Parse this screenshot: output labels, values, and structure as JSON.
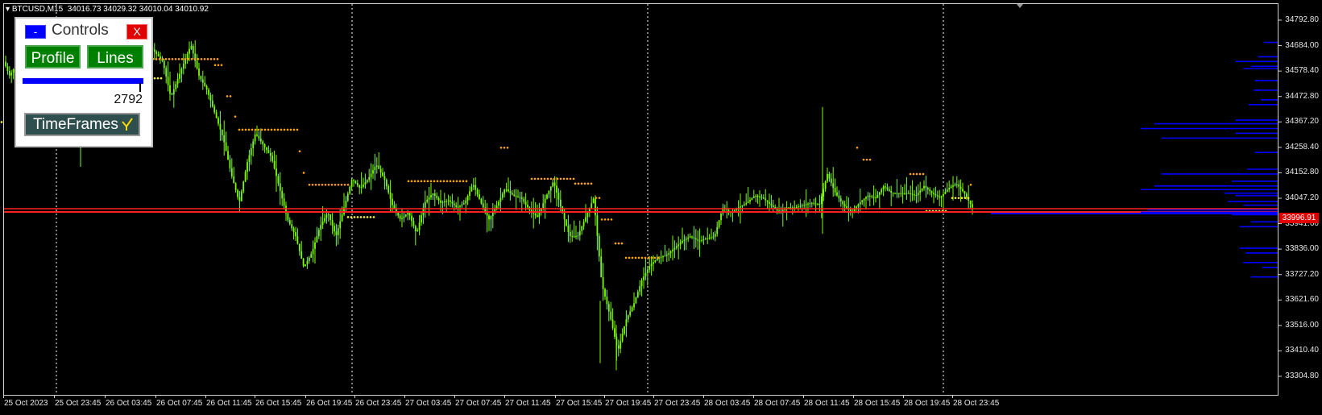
{
  "header": {
    "symbol": "BTCUSD,M15",
    "ohlc": "34016.73 34029.32 34010.04 34010.92"
  },
  "price_axis": {
    "labels": [
      "34792.80",
      "34684.00",
      "34578.40",
      "34472.80",
      "34367.20",
      "34258.40",
      "34152.80",
      "34047.20",
      "33941.60",
      "33836.00",
      "33727.20",
      "33621.60",
      "33516.00",
      "33410.40",
      "33304.80"
    ],
    "current_price": "33996.91"
  },
  "time_axis": {
    "labels": [
      "25 Oct 2023",
      "25 Oct 23:45",
      "26 Oct 03:45",
      "26 Oct 07:45",
      "26 Oct 11:45",
      "26 Oct 15:45",
      "26 Oct 19:45",
      "26 Oct 23:45",
      "27 Oct 03:45",
      "27 Oct 07:45",
      "27 Oct 11:45",
      "27 Oct 15:45",
      "27 Oct 19:45",
      "27 Oct 23:45",
      "28 Oct 03:45",
      "28 Oct 07:45",
      "28 Oct 11:45",
      "28 Oct 15:45",
      "28 Oct 19:45",
      "28 Oct 23:45"
    ]
  },
  "controls": {
    "minimize_label": "-",
    "title": "Controls",
    "close_label": "X",
    "profile_button": "Profile",
    "lines_button": "Lines",
    "slider_value": "2792",
    "timeframes_label": "TimeFrames"
  },
  "colors": {
    "background": "#000000",
    "candles": "#7CFC00",
    "red_line": "#ff2020",
    "profile_bars": "#0000ff",
    "dots_orange": "#ffa500",
    "dots_yellow": "#ffff00",
    "grid": "#ffffff"
  },
  "chart_data": {
    "type": "candlestick",
    "symbol": "BTCUSD",
    "timeframe": "M15",
    "ylim": [
      33260,
      34850
    ],
    "horizontal_level": 33996.91,
    "path_points": [
      [
        0,
        34640
      ],
      [
        10,
        34560
      ],
      [
        20,
        34620
      ],
      [
        30,
        34460
      ],
      [
        40,
        34530
      ],
      [
        55,
        34610
      ],
      [
        66,
        34380
      ],
      [
        80,
        34500
      ],
      [
        95,
        34310
      ],
      [
        110,
        34480
      ],
      [
        125,
        34600
      ],
      [
        140,
        34520
      ],
      [
        155,
        34640
      ],
      [
        170,
        34600
      ],
      [
        185,
        34680
      ],
      [
        200,
        34620
      ],
      [
        210,
        34470
      ],
      [
        220,
        34560
      ],
      [
        235,
        34690
      ],
      [
        245,
        34560
      ],
      [
        255,
        34500
      ],
      [
        265,
        34400
      ],
      [
        275,
        34300
      ],
      [
        285,
        34150
      ],
      [
        295,
        34030
      ],
      [
        305,
        34200
      ],
      [
        315,
        34320
      ],
      [
        325,
        34270
      ],
      [
        335,
        34220
      ],
      [
        345,
        34090
      ],
      [
        355,
        33960
      ],
      [
        365,
        33890
      ],
      [
        375,
        33760
      ],
      [
        385,
        33820
      ],
      [
        395,
        33930
      ],
      [
        405,
        33990
      ],
      [
        415,
        33890
      ],
      [
        425,
        34010
      ],
      [
        435,
        34130
      ],
      [
        445,
        34090
      ],
      [
        455,
        34130
      ],
      [
        465,
        34190
      ],
      [
        475,
        34130
      ],
      [
        485,
        34020
      ],
      [
        495,
        33960
      ],
      [
        505,
        33990
      ],
      [
        515,
        33900
      ],
      [
        525,
        34030
      ],
      [
        535,
        34070
      ],
      [
        545,
        34030
      ],
      [
        555,
        34040
      ],
      [
        565,
        34010
      ],
      [
        575,
        34030
      ],
      [
        585,
        34110
      ],
      [
        595,
        34030
      ],
      [
        605,
        33960
      ],
      [
        615,
        34020
      ],
      [
        625,
        34090
      ],
      [
        635,
        34060
      ],
      [
        645,
        34050
      ],
      [
        655,
        34000
      ],
      [
        665,
        33970
      ],
      [
        675,
        34050
      ],
      [
        685,
        34120
      ],
      [
        695,
        34000
      ],
      [
        705,
        33890
      ],
      [
        715,
        33890
      ],
      [
        725,
        33970
      ],
      [
        735,
        34050
      ],
      [
        745,
        33690
      ],
      [
        755,
        33560
      ],
      [
        765,
        33410
      ],
      [
        775,
        33540
      ],
      [
        785,
        33610
      ],
      [
        795,
        33710
      ],
      [
        805,
        33770
      ],
      [
        815,
        33800
      ],
      [
        825,
        33810
      ],
      [
        835,
        33840
      ],
      [
        845,
        33870
      ],
      [
        855,
        33890
      ],
      [
        865,
        33870
      ],
      [
        875,
        33880
      ],
      [
        885,
        33890
      ],
      [
        895,
        34010
      ],
      [
        905,
        33990
      ],
      [
        915,
        34010
      ],
      [
        925,
        34030
      ],
      [
        935,
        34060
      ],
      [
        945,
        34050
      ],
      [
        955,
        34020
      ],
      [
        965,
        33990
      ],
      [
        975,
        34010
      ],
      [
        985,
        34010
      ],
      [
        995,
        34020
      ],
      [
        1005,
        34030
      ],
      [
        1015,
        34020
      ],
      [
        1025,
        34150
      ],
      [
        1035,
        34070
      ],
      [
        1045,
        34020
      ],
      [
        1055,
        33990
      ],
      [
        1065,
        34030
      ],
      [
        1075,
        34060
      ],
      [
        1085,
        34050
      ],
      [
        1095,
        34100
      ],
      [
        1105,
        34070
      ],
      [
        1115,
        34070
      ],
      [
        1125,
        34070
      ],
      [
        1135,
        34060
      ],
      [
        1145,
        34100
      ],
      [
        1155,
        34070
      ],
      [
        1165,
        34050
      ],
      [
        1175,
        34090
      ],
      [
        1185,
        34110
      ],
      [
        1195,
        34070
      ],
      [
        1205,
        34010
      ]
    ],
    "dot_steps": [
      [
        0,
        3,
        34367,
        "yellow"
      ],
      [
        180,
        270,
        34630,
        "orange"
      ],
      [
        190,
        200,
        34550,
        "yellow"
      ],
      [
        265,
        275,
        34605,
        "orange"
      ],
      [
        280,
        287,
        34475,
        "orange"
      ],
      [
        290,
        292,
        34390,
        "orange"
      ],
      [
        295,
        370,
        34335,
        "orange"
      ],
      [
        370,
        372,
        34245,
        "orange"
      ],
      [
        375,
        378,
        34155,
        "orange"
      ],
      [
        382,
        430,
        34105,
        "orange"
      ],
      [
        430,
        465,
        33970,
        "yellow"
      ],
      [
        505,
        580,
        34120,
        "orange"
      ],
      [
        620,
        630,
        34260,
        "orange"
      ],
      [
        658,
        710,
        34130,
        "orange"
      ],
      [
        712,
        735,
        34110,
        "orange"
      ],
      [
        738,
        742,
        34050,
        "orange"
      ],
      [
        745,
        760,
        33960,
        "orange"
      ],
      [
        762,
        772,
        33860,
        "orange"
      ],
      [
        775,
        815,
        33800,
        "orange"
      ],
      [
        1062,
        1065,
        34260,
        "orange"
      ],
      [
        1070,
        1078,
        34210,
        "orange"
      ],
      [
        1128,
        1145,
        34150,
        "orange"
      ],
      [
        1148,
        1175,
        33995,
        "yellow"
      ],
      [
        1180,
        1200,
        34050,
        "yellow"
      ],
      [
        1203,
        1205,
        34105,
        "orange"
      ]
    ],
    "volume_profile": [
      [
        34700,
        0.18
      ],
      [
        34640,
        0.26
      ],
      [
        34620,
        0.55
      ],
      [
        34600,
        0.35
      ],
      [
        34590,
        0.45
      ],
      [
        34540,
        0.3
      ],
      [
        34500,
        0.32
      ],
      [
        34460,
        0.22
      ],
      [
        34440,
        0.38
      ],
      [
        34375,
        0.55
      ],
      [
        34360,
        0.9
      ],
      [
        34340,
        1.0
      ],
      [
        34320,
        0.55
      ],
      [
        34300,
        0.85
      ],
      [
        34240,
        0.3
      ],
      [
        34170,
        0.4
      ],
      [
        34150,
        0.85
      ],
      [
        34120,
        0.6
      ],
      [
        34100,
        0.9
      ],
      [
        34085,
        1.0
      ],
      [
        34070,
        0.7
      ],
      [
        34060,
        0.55
      ],
      [
        34035,
        0.65
      ],
      [
        34020,
        0.45
      ],
      [
        34000,
        0.95
      ],
      [
        33990,
        1.0
      ],
      [
        33980,
        0.6
      ],
      [
        33950,
        0.35
      ],
      [
        33930,
        0.5
      ],
      [
        33840,
        0.5
      ],
      [
        33820,
        0.42
      ],
      [
        33780,
        0.45
      ],
      [
        33760,
        0.2
      ],
      [
        33720,
        0.35
      ]
    ],
    "profile_dark_line": 33985
  }
}
